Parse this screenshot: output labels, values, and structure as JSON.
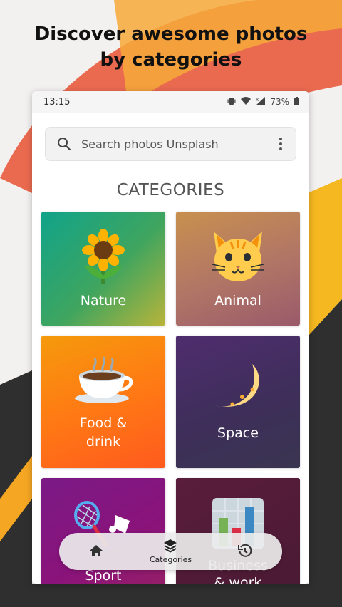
{
  "headline": {
    "line1": "Discover awesome photos",
    "line2": "by categories"
  },
  "status_bar": {
    "time": "13:15",
    "battery": "73%",
    "icons": [
      "vibrate-icon",
      "wifi-icon",
      "signal-icon",
      "battery-icon"
    ]
  },
  "search": {
    "placeholder": "Search photos Unsplash",
    "icon": "search-icon",
    "menu_icon": "more-vert-icon"
  },
  "section_title": "CATEGORIES",
  "categories": [
    {
      "label": "Nature",
      "icon": "sunflower-icon"
    },
    {
      "label": "Animal",
      "icon": "cat-face-icon"
    },
    {
      "label": "Food &",
      "label2": "drink",
      "icon": "hot-beverage-icon"
    },
    {
      "label": "Space",
      "icon": "crescent-moon-icon"
    },
    {
      "label": "Sport",
      "icon": "badminton-icon"
    },
    {
      "label": "Business",
      "label2": "& work",
      "icon": "bar-chart-icon"
    }
  ],
  "bottom_nav": [
    {
      "label": "",
      "icon": "home-icon"
    },
    {
      "label": "Categories",
      "icon": "layers-icon"
    },
    {
      "label": "",
      "icon": "history-icon"
    }
  ],
  "colors": {
    "accent_orange": "#f5a623",
    "accent_red": "#e8514a",
    "dark_bg": "#2d2d2d"
  }
}
